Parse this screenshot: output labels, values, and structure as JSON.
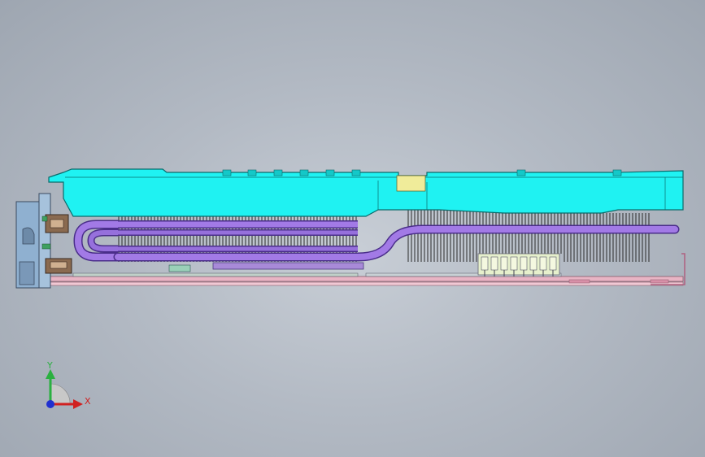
{
  "triad": {
    "x_label": "X",
    "y_label": "Y"
  },
  "colors": {
    "shroud": "#1ff2f2",
    "heatpipe": "#8a5cd8",
    "fins": "#2a2a2a",
    "pcb": "#e8b4c4",
    "bracket": "#8fb0d0",
    "connector": "#8a6a50",
    "memory": "#e6f0cc"
  }
}
